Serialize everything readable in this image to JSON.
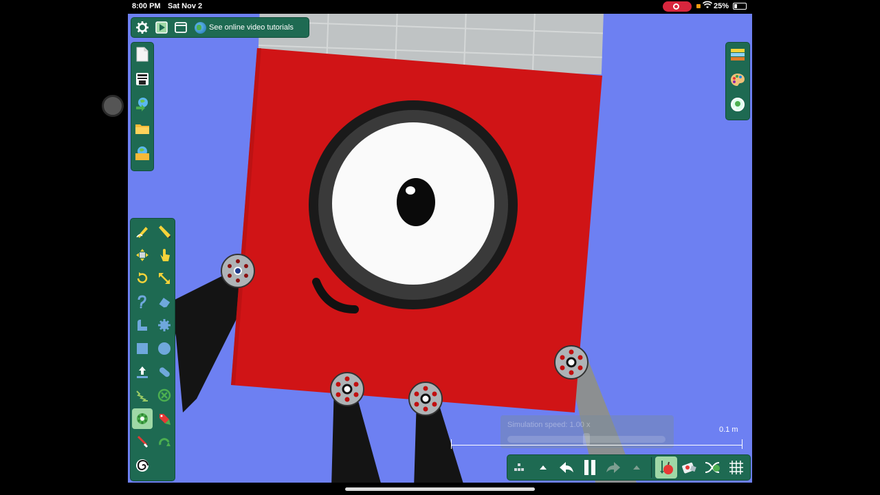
{
  "status_bar": {
    "time": "8:00 PM",
    "date": "Sat Nov 2",
    "battery_percent": "25%",
    "battery_level": 0.25,
    "icons": [
      "screen-record-icon",
      "orange-privacy-dot",
      "wifi-icon",
      "battery-icon"
    ]
  },
  "top_toolbar": {
    "buttons": [
      "gear-icon",
      "play-icon",
      "window-icon"
    ],
    "tutorials_link": "See online video tutorials"
  },
  "file_panel": {
    "buttons": [
      "new-document-icon",
      "save-icon",
      "open-web-icon",
      "open-folder-icon",
      "save-web-icon"
    ]
  },
  "right_panel": {
    "buttons": [
      "layers-icon",
      "palette-icon",
      "zoom-to-fit-icon"
    ]
  },
  "tools_panel": {
    "buttons": [
      "sketch-icon",
      "pencil-icon",
      "move-icon",
      "drag-hand-icon",
      "rotate-icon",
      "scale-icon",
      "rope-icon",
      "eraser-icon",
      "spline-icon",
      "gear-shape-icon",
      "box-icon",
      "circle-icon",
      "thruster-icon",
      "capsule-icon",
      "spring-icon",
      "fixate-icon",
      "hinge-icon",
      "tracer-icon",
      "laser-icon",
      "attach-icon",
      "spiral-icon"
    ],
    "active": "hinge-icon"
  },
  "simulation": {
    "speed_label": "Simulation speed:",
    "speed_value": "1.00",
    "speed_suffix": "x",
    "scale_label": "0.1 m"
  },
  "bottom_bar": {
    "buttons": [
      "grid-dots-icon",
      "chevron-up-icon",
      "undo-icon",
      "pause-icon",
      "redo-icon",
      "chevron-up-icon",
      "gravity-apple-icon",
      "collision-icon",
      "camera-follow-icon",
      "grid-toggle-icon"
    ]
  },
  "colors": {
    "canvas_bg": "#6d80f2",
    "toolbar_bg": "#1e6a52",
    "character_red": "#d01416",
    "limb_black": "#141414"
  }
}
